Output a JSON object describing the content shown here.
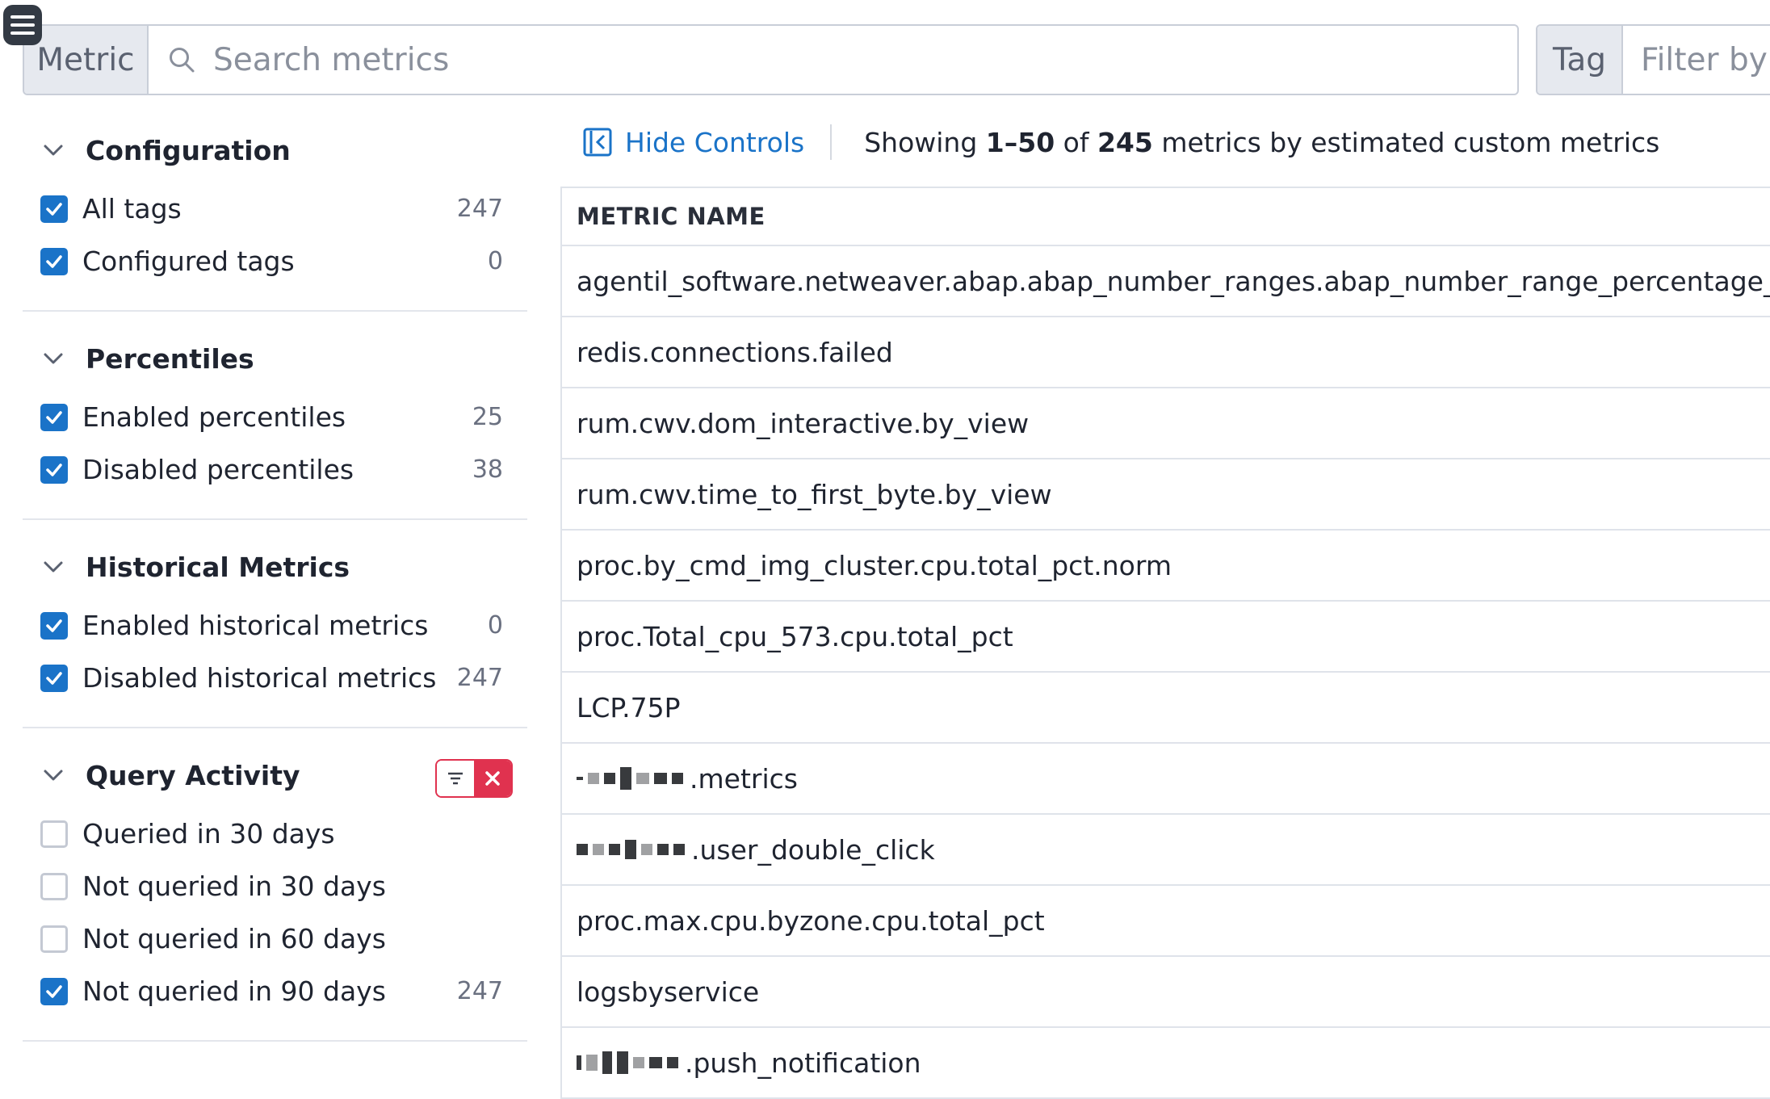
{
  "search": {
    "prefix": "Metric",
    "placeholder": "Search metrics",
    "tag_prefix": "Tag",
    "tag_placeholder": "Filter by T"
  },
  "sidebar": {
    "sections": [
      {
        "title": "Configuration",
        "items": [
          {
            "label": "All tags",
            "count": "247",
            "checked": true
          },
          {
            "label": "Configured tags",
            "count": "0",
            "checked": true
          }
        ]
      },
      {
        "title": "Percentiles",
        "items": [
          {
            "label": "Enabled percentiles",
            "count": "25",
            "checked": true
          },
          {
            "label": "Disabled percentiles",
            "count": "38",
            "checked": true
          }
        ]
      },
      {
        "title": "Historical Metrics",
        "items": [
          {
            "label": "Enabled historical metrics",
            "count": "0",
            "checked": true
          },
          {
            "label": "Disabled historical metrics",
            "count": "247",
            "checked": true
          }
        ]
      },
      {
        "title": "Query Activity",
        "items": [
          {
            "label": "Queried in 30 days",
            "count": "",
            "checked": false
          },
          {
            "label": "Not queried in 30 days",
            "count": "",
            "checked": false
          },
          {
            "label": "Not queried in 60 days",
            "count": "",
            "checked": false
          },
          {
            "label": "Not queried in 90 days",
            "count": "247",
            "checked": true
          }
        ]
      }
    ]
  },
  "controls": {
    "hide_label": "Hide Controls",
    "showing_prefix": "Showing ",
    "showing_range": "1–50",
    "showing_of": " of ",
    "showing_total": "245",
    "showing_suffix": " metrics by estimated custom metrics"
  },
  "table": {
    "header": "METRIC NAME",
    "rows": [
      "agentil_software.netweaver.abap.abap_number_ranges.abap_number_range_percentage_used",
      "redis.connections.failed",
      "rum.cwv.dom_interactive.by_view",
      "rum.cwv.time_to_first_byte.by_view",
      "proc.by_cmd_img_cluster.cpu.total_pct.norm",
      "proc.Total_cpu_573.cpu.total_pct",
      "LCP.75P",
      ".metrics",
      ".user_double_click",
      "proc.max.cpu.byzone.cpu.total_pct",
      "logsbyservice",
      ".push_notification"
    ]
  },
  "colors": {
    "accent": "#1a73c8",
    "danger": "#e0324f",
    "border": "#dfe3ea"
  }
}
